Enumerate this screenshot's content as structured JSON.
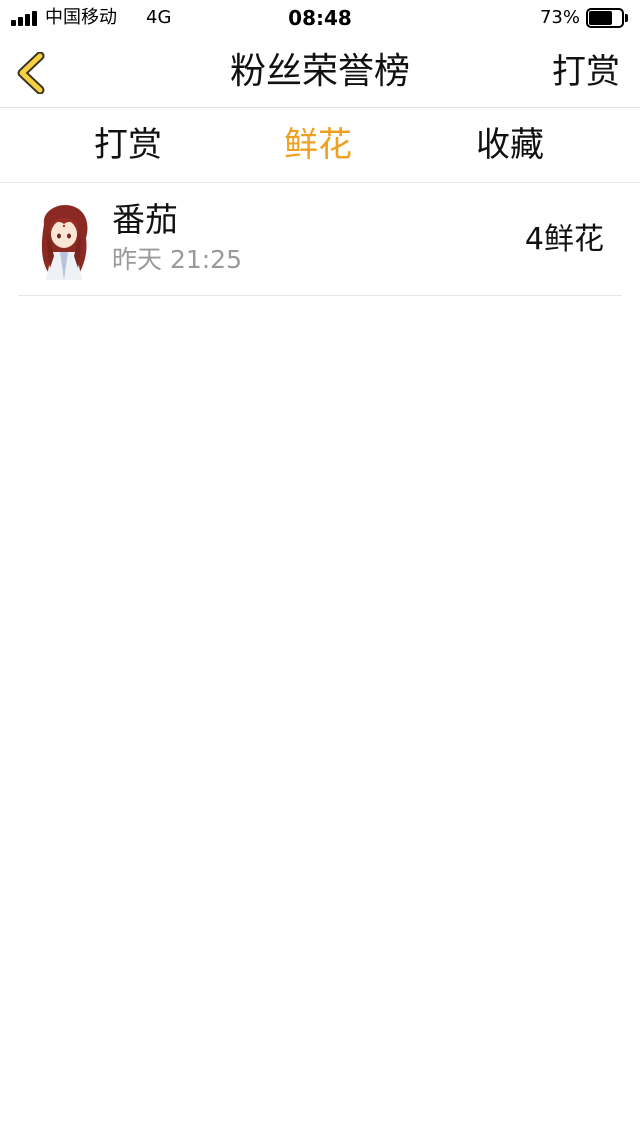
{
  "status_bar": {
    "carrier": "中国移动",
    "network": "4G",
    "time": "08:48",
    "battery_percent": "73%",
    "battery_level": 0.73,
    "signal_icon": "signal-bars-icon",
    "battery_icon": "battery-icon"
  },
  "nav": {
    "title": "粉丝荣誉榜",
    "right_label": "打赏",
    "back_icon": "chevron-left-icon",
    "accent_color": "#f0a020"
  },
  "tabs": [
    {
      "label": "打赏",
      "active": false
    },
    {
      "label": "鲜花",
      "active": true
    },
    {
      "label": "收藏",
      "active": false
    }
  ],
  "list": {
    "items": [
      {
        "name": "番茄",
        "time": "昨天 21:25",
        "amount": "4鲜花",
        "avatar_icon": "avatar-chibi-character"
      }
    ]
  }
}
